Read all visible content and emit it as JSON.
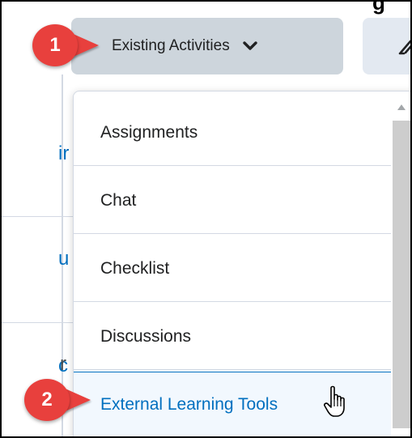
{
  "header": {
    "existing_activities_label": "Existing Activities",
    "clipped_title_glyph": "g"
  },
  "background_fragments": [
    "ir",
    "u",
    "c",
    "r"
  ],
  "menu": {
    "items": [
      {
        "label": "Assignments"
      },
      {
        "label": "Chat"
      },
      {
        "label": "Checklist"
      },
      {
        "label": "Discussions"
      },
      {
        "label": "External Learning Tools",
        "highlighted": true
      }
    ]
  },
  "callouts": [
    {
      "number": "1",
      "color": "#e8403d"
    },
    {
      "number": "2",
      "color": "#e8403d"
    }
  ],
  "icons": {
    "chevron": "chevron-down-icon",
    "second_button": "pencil-icon",
    "cursor": "hand-pointer-icon"
  },
  "colors": {
    "accent": "#006fbf",
    "button_bg": "#cdd5dc",
    "highlight_bg": "#f2f8fe",
    "callout": "#e8403d"
  }
}
